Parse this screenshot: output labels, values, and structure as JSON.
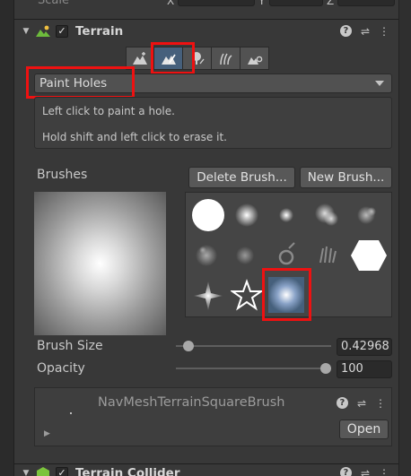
{
  "scale_row": {
    "label": "Scale",
    "axes": [
      "X",
      "Y",
      "Z"
    ]
  },
  "terrain": {
    "title": "Terrain",
    "enabled": true,
    "tools": [
      {
        "icon": "raise-lower-terrain-icon",
        "active": false
      },
      {
        "icon": "paint-terrain-icon",
        "active": true
      },
      {
        "icon": "paint-trees-icon",
        "active": false
      },
      {
        "icon": "paint-details-icon",
        "active": false
      },
      {
        "icon": "terrain-settings-icon",
        "active": false
      }
    ],
    "mode": "Paint Holes",
    "help": {
      "line1": "Left click to paint a hole.",
      "line2": "Hold shift and left click to erase it."
    },
    "brushes": {
      "label": "Brushes",
      "delete_label": "Delete Brush...",
      "new_label": "New Brush..."
    },
    "brush_size": {
      "label": "Brush Size",
      "value": "0.42968",
      "fraction": 0.05
    },
    "opacity": {
      "label": "Opacity",
      "value": "100",
      "fraction": 1.0
    },
    "brush_asset": {
      "name": "NavMeshTerrainSquareBrush",
      "open_label": "Open"
    }
  },
  "collider": {
    "title": "Terrain Collider",
    "enabled": true
  },
  "colors": {
    "highlight": "#ee1111",
    "active_tool": "#46607c",
    "panel": "#383838"
  }
}
